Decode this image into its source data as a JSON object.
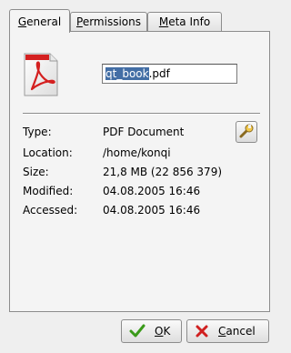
{
  "tabs": [
    {
      "label": "General",
      "mnemonic": "G",
      "rest": "eneral",
      "active": true
    },
    {
      "label": "Permissions",
      "mnemonic": "P",
      "rest": "ermissions",
      "active": false
    },
    {
      "label": "Meta Info",
      "mnemonic": "M",
      "rest": "eta Info",
      "active": false
    }
  ],
  "file": {
    "name_selected": "qt_book",
    "name_rest": ".pdf",
    "icon": "pdf-document-icon"
  },
  "properties": [
    {
      "label": "Type:",
      "value": "PDF Document"
    },
    {
      "label": "Location:",
      "value": "/home/konqi"
    },
    {
      "label": "Size:",
      "value": "21,8 MB (22 856 379)"
    },
    {
      "label": "Modified:",
      "value": "04.08.2005 16:46"
    },
    {
      "label": "Accessed:",
      "value": "04.08.2005 16:46"
    }
  ],
  "buttons": {
    "ok": {
      "mnemonic": "O",
      "rest": "K"
    },
    "cancel": {
      "mnemonic": "C",
      "rest": "ancel"
    }
  },
  "colors": {
    "selection": "#436ea5",
    "pdf_red": "#d42020",
    "ok_green": "#3a9a1a",
    "cancel_red": "#d02020"
  }
}
